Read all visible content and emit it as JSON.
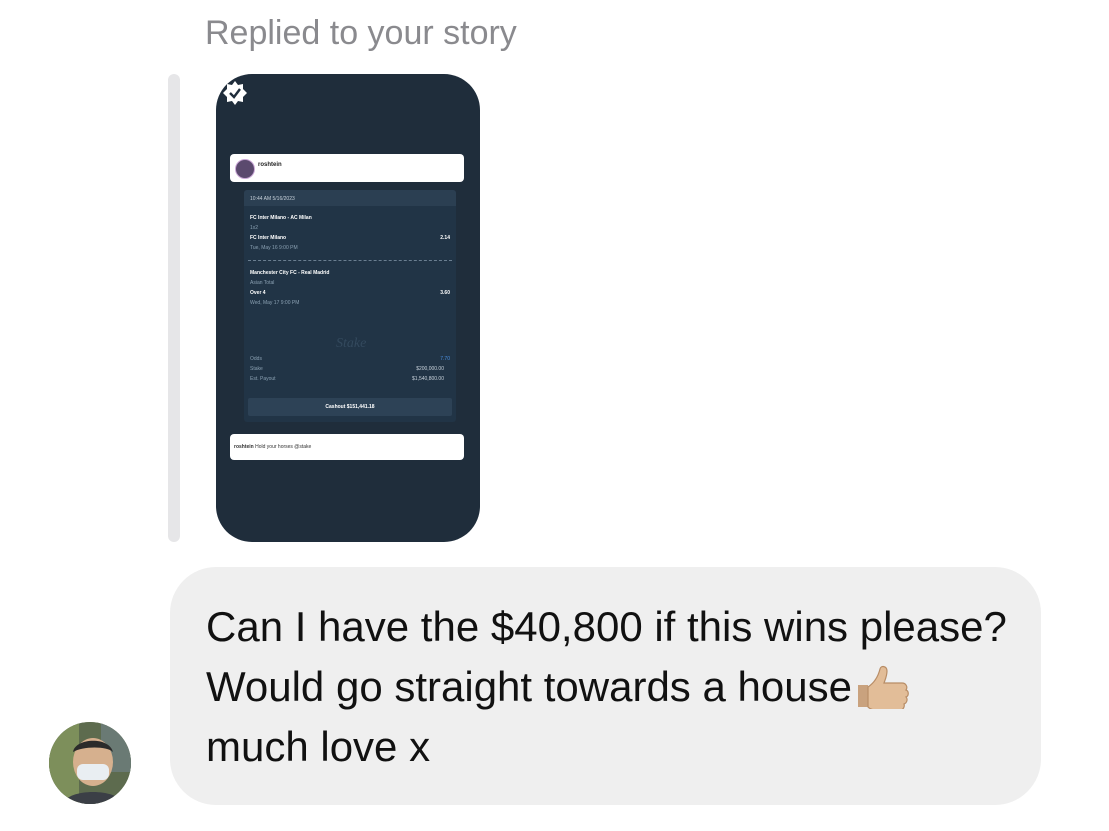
{
  "header": {
    "replied_label": "Replied to your story"
  },
  "story": {
    "post_username": "roshtein",
    "timestamp": "10:44 AM 5/16/2023",
    "bets": [
      {
        "match": "FC Inter Milano - AC Milan",
        "market": "1x2",
        "selection": "FC Inter Milano",
        "odds": "2.14",
        "datetime": "Tue, May 16 9:00 PM"
      },
      {
        "match": "Manchester City FC - Real Madrid",
        "market": "Asian Total",
        "selection": "Over 4",
        "odds": "3.60",
        "datetime": "Wed, May 17 9:00 PM"
      }
    ],
    "watermark": "Stake",
    "summary": {
      "odds_label": "Odds",
      "odds_value": "7.70",
      "stake_label": "Stake",
      "stake_value": "$200,000.00",
      "payout_label": "Est. Payout",
      "payout_value": "$1,540,800.00"
    },
    "cashout_label": "Cashout $151,441.18",
    "caption_user": "roshtein",
    "caption_text": "Hold your horses @stake"
  },
  "message": {
    "text_before_emoji": "Can I have the $40,800 if this wins please? Would go straight towards a house",
    "emoji": "thumbs-up",
    "text_after_emoji": "much love x"
  },
  "colors": {
    "bubble_bg": "#efefef",
    "story_bg": "#1f2d3b",
    "meta_text": "#8a8a8e",
    "link_blue": "#3a7bd5"
  }
}
